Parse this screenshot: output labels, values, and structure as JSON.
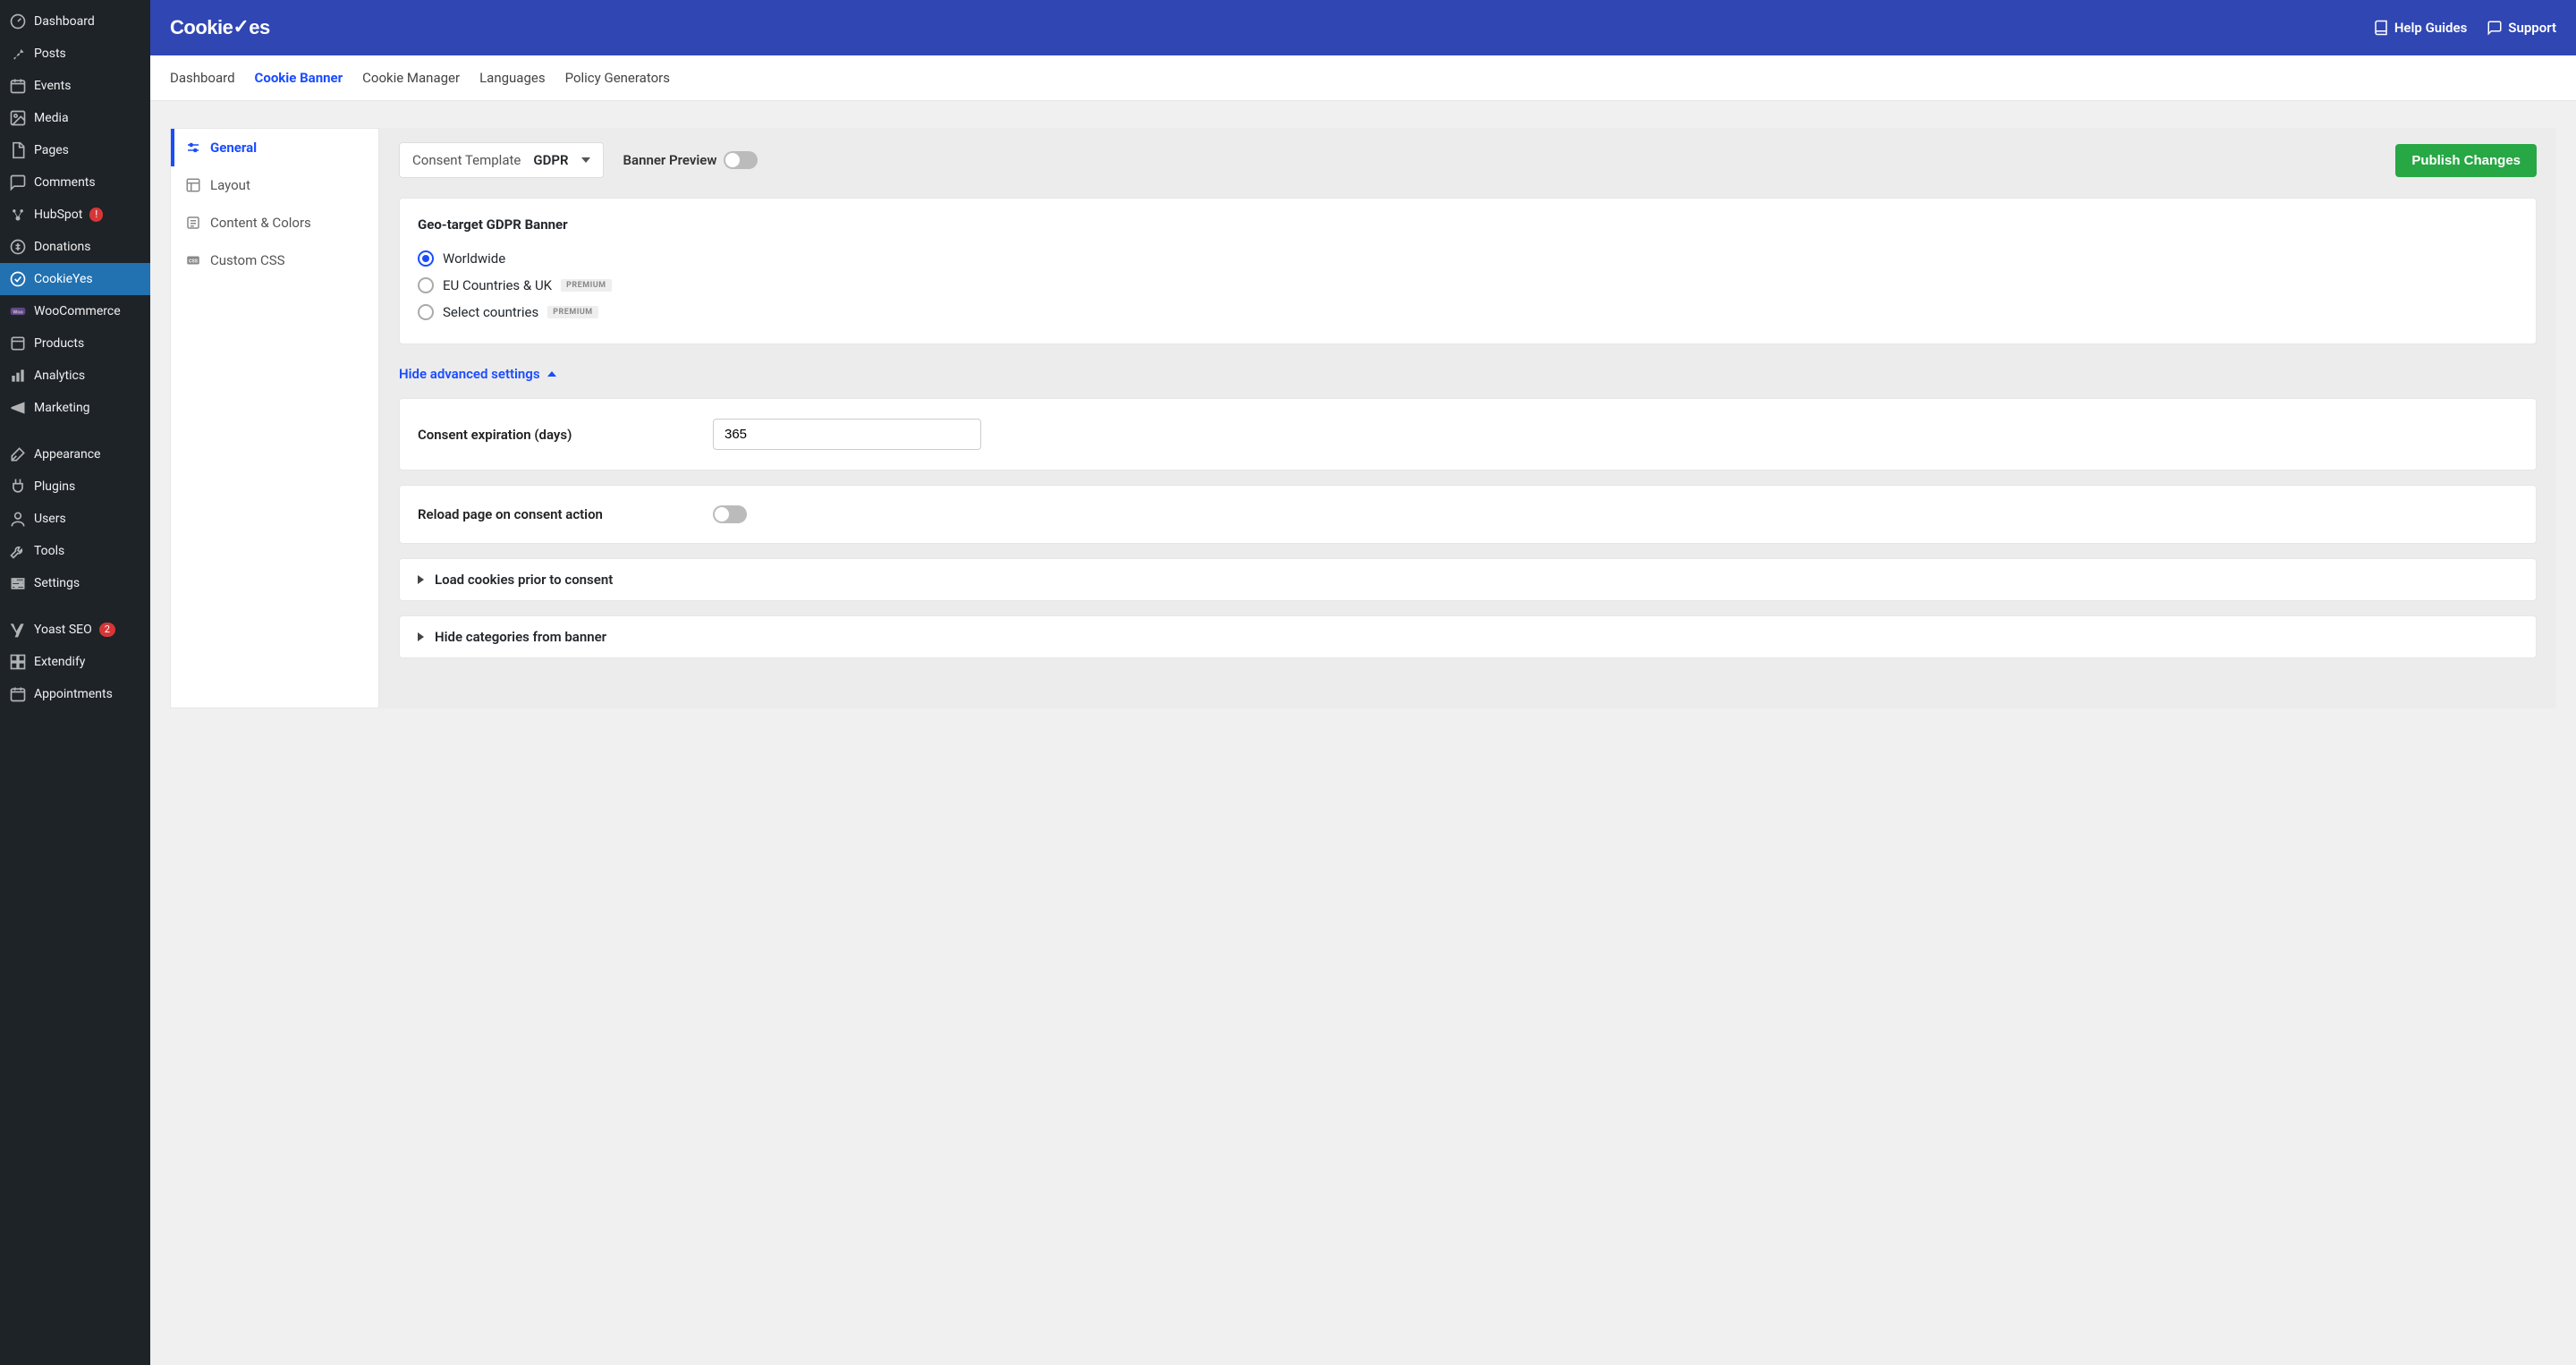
{
  "wp_sidebar": [
    {
      "icon": "dashboard",
      "label": "Dashboard"
    },
    {
      "icon": "pin",
      "label": "Posts"
    },
    {
      "icon": "calendar",
      "label": "Events"
    },
    {
      "icon": "media",
      "label": "Media"
    },
    {
      "icon": "page",
      "label": "Pages"
    },
    {
      "icon": "comment",
      "label": "Comments"
    },
    {
      "icon": "hubspot",
      "label": "HubSpot",
      "badge": "!"
    },
    {
      "icon": "donation",
      "label": "Donations"
    },
    {
      "icon": "cookieyes",
      "label": "CookieYes",
      "active": true
    },
    {
      "icon": "woo",
      "label": "WooCommerce"
    },
    {
      "icon": "products",
      "label": "Products"
    },
    {
      "icon": "analytics",
      "label": "Analytics"
    },
    {
      "icon": "marketing",
      "label": "Marketing"
    },
    {
      "gap": true
    },
    {
      "icon": "appearance",
      "label": "Appearance"
    },
    {
      "icon": "plugins",
      "label": "Plugins"
    },
    {
      "icon": "users",
      "label": "Users"
    },
    {
      "icon": "tools",
      "label": "Tools"
    },
    {
      "icon": "settings",
      "label": "Settings"
    },
    {
      "gap": true
    },
    {
      "icon": "yoast",
      "label": "Yoast SEO",
      "badge": "2"
    },
    {
      "icon": "extendify",
      "label": "Extendify"
    },
    {
      "icon": "appointments",
      "label": "Appointments"
    }
  ],
  "bluebar": {
    "brand": "CookieYes",
    "help": "Help Guides",
    "support": "Support"
  },
  "subnav": [
    {
      "label": "Dashboard"
    },
    {
      "label": "Cookie Banner",
      "active": true
    },
    {
      "label": "Cookie Manager"
    },
    {
      "label": "Languages"
    },
    {
      "label": "Policy Generators"
    }
  ],
  "leftnav": [
    {
      "label": "General",
      "active": true,
      "icon": "sliders"
    },
    {
      "label": "Layout",
      "icon": "layout"
    },
    {
      "label": "Content & Colors",
      "icon": "content"
    },
    {
      "label": "Custom CSS",
      "icon": "css"
    }
  ],
  "toolbar": {
    "template_label": "Consent Template",
    "template_value": "GDPR",
    "preview_label": "Banner Preview",
    "publish": "Publish Changes"
  },
  "geo": {
    "title": "Geo-target GDPR Banner",
    "opt_worldwide": "Worldwide",
    "opt_eu": "EU Countries & UK",
    "opt_select": "Select countries",
    "premium": "PREMIUM"
  },
  "advanced_link": "Hide advanced settings",
  "settings": {
    "expiration_label": "Consent expiration (days)",
    "expiration_value": "365",
    "reload_label": "Reload page on consent action",
    "load_cookies": "Load cookies prior to consent",
    "hide_categories": "Hide categories from banner"
  }
}
